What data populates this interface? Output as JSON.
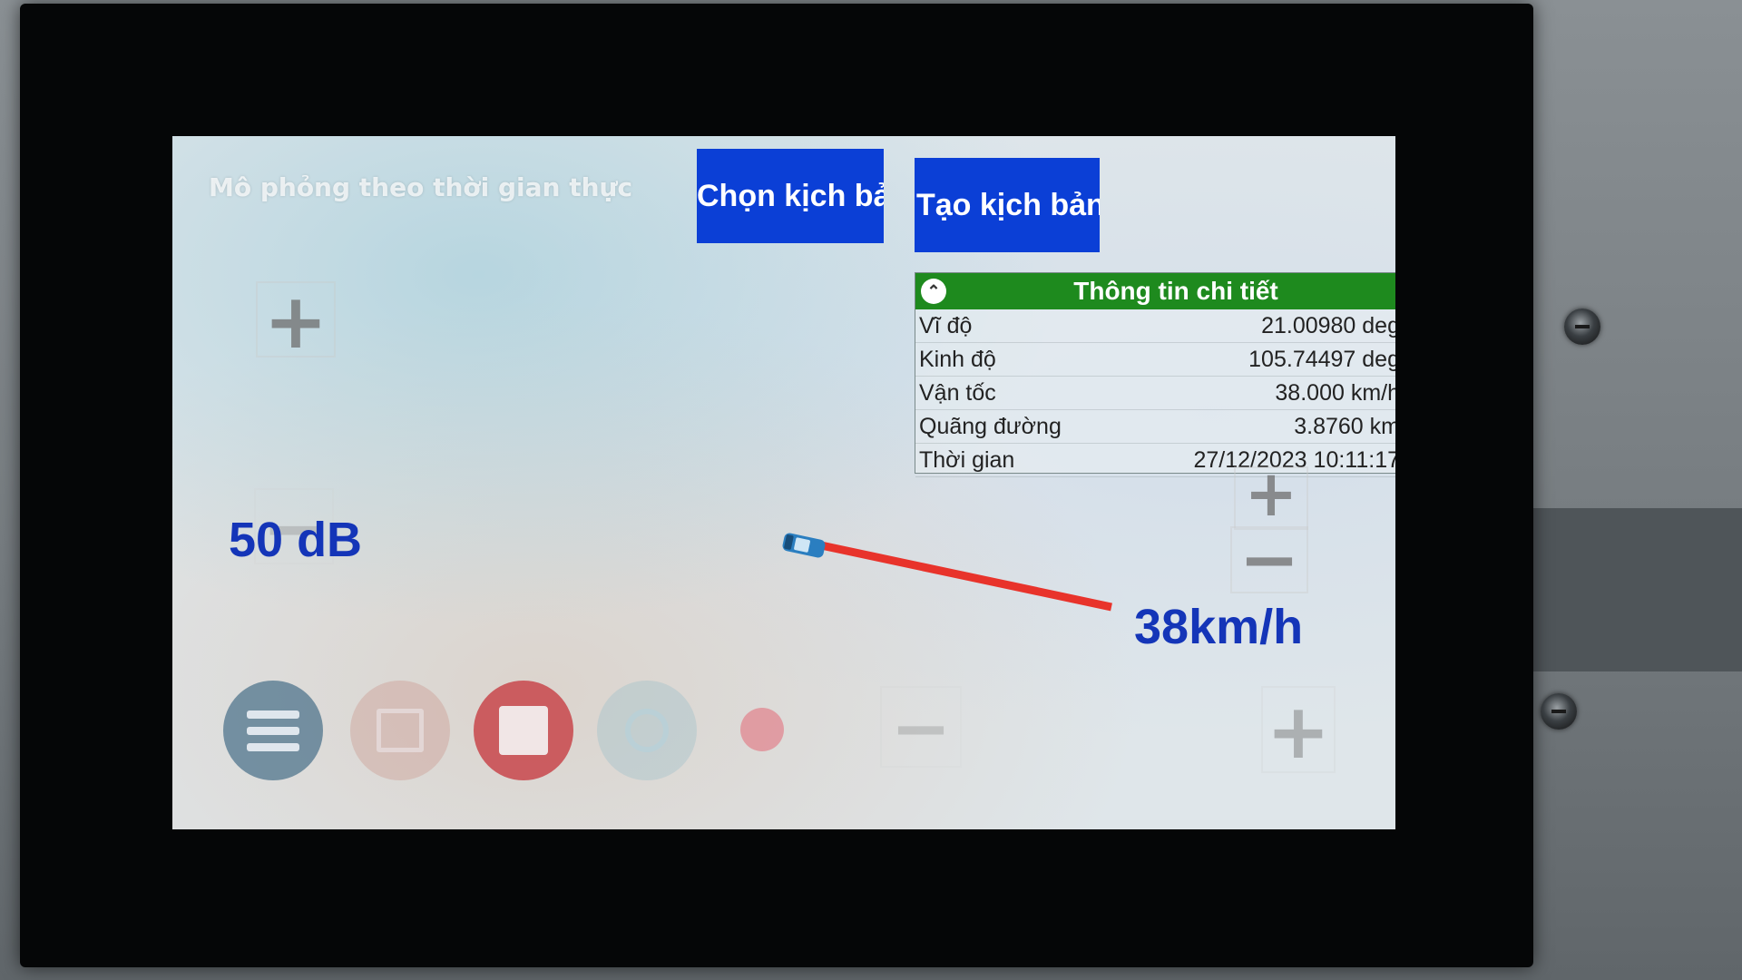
{
  "sim_title": "Mô phỏng theo thời gian thực",
  "buttons": {
    "choose_scenario": "Chọn kịch bả",
    "create_scenario": "Tạo kịch bản"
  },
  "map_controls": {
    "zoom_in_symbol": "+",
    "zoom_out_symbol": "−"
  },
  "sound_level": "50 dB",
  "speed_display": "38km/h",
  "detail_panel": {
    "title": "Thông tin chi tiết",
    "rows": [
      {
        "label": "Vĩ độ",
        "value": "21.00980 deg"
      },
      {
        "label": "Kinh độ",
        "value": "105.74497 deg"
      },
      {
        "label": "Vận tốc",
        "value": "38.000 km/h"
      },
      {
        "label": "Quãng đường",
        "value": "3.8760 km"
      },
      {
        "label": "Thời gian",
        "value": "27/12/2023 10:11:17"
      }
    ]
  },
  "icons": {
    "collapse": "chevron-up-icon",
    "list": "list-icon",
    "save": "save-icon",
    "stop": "stop-icon",
    "refresh": "refresh-icon",
    "record": "record-icon",
    "car": "car-icon"
  },
  "colors": {
    "button_blue": "#0b3fd6",
    "panel_header_green": "#1e8a1e",
    "route_red": "#e8332b",
    "readout_blue": "#1435b8"
  }
}
